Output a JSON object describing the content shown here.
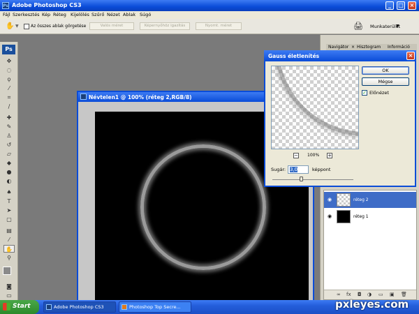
{
  "app": {
    "title": "Adobe Photoshop CS3",
    "logo": "Ps"
  },
  "menu": [
    "Fájl",
    "Szerkesztés",
    "Kép",
    "Réteg",
    "Kijelölés",
    "Szűrő",
    "Nézet",
    "Ablak",
    "Súgó"
  ],
  "options": {
    "scroll_all_label": "Az összes ablak görgetése",
    "buttons": [
      "Valós méret",
      "Képernyőhöz igazítás",
      "Nyomt. méret"
    ],
    "workspace": "Munkaterület"
  },
  "document": {
    "title": "Névtelen1 @ 100% (réteg 2,RGB/8)"
  },
  "panel_tabs": [
    "Navigátor",
    "Hisztogram",
    "Információ"
  ],
  "layers": [
    {
      "name": "réteg 2",
      "selected": true
    },
    {
      "name": "réteg 1",
      "selected": false
    }
  ],
  "dialog": {
    "title": "Gauss életlenítés",
    "ok_label": "OK",
    "cancel_label": "Mégse",
    "preview_label": "Előnézet",
    "preview_checked": true,
    "zoom_label": "100%",
    "zoom_minus": "−",
    "zoom_plus": "+",
    "radius_label": "Sugár:",
    "radius_value": "3,0",
    "radius_unit": "képpont",
    "radius_slider_fraction": 0.35
  },
  "taskbar": {
    "start_label": "Start",
    "items": [
      "Adobe Photoshop CS3",
      "Photoshop Top Secre..."
    ]
  },
  "watermark": "pxleyes.com"
}
